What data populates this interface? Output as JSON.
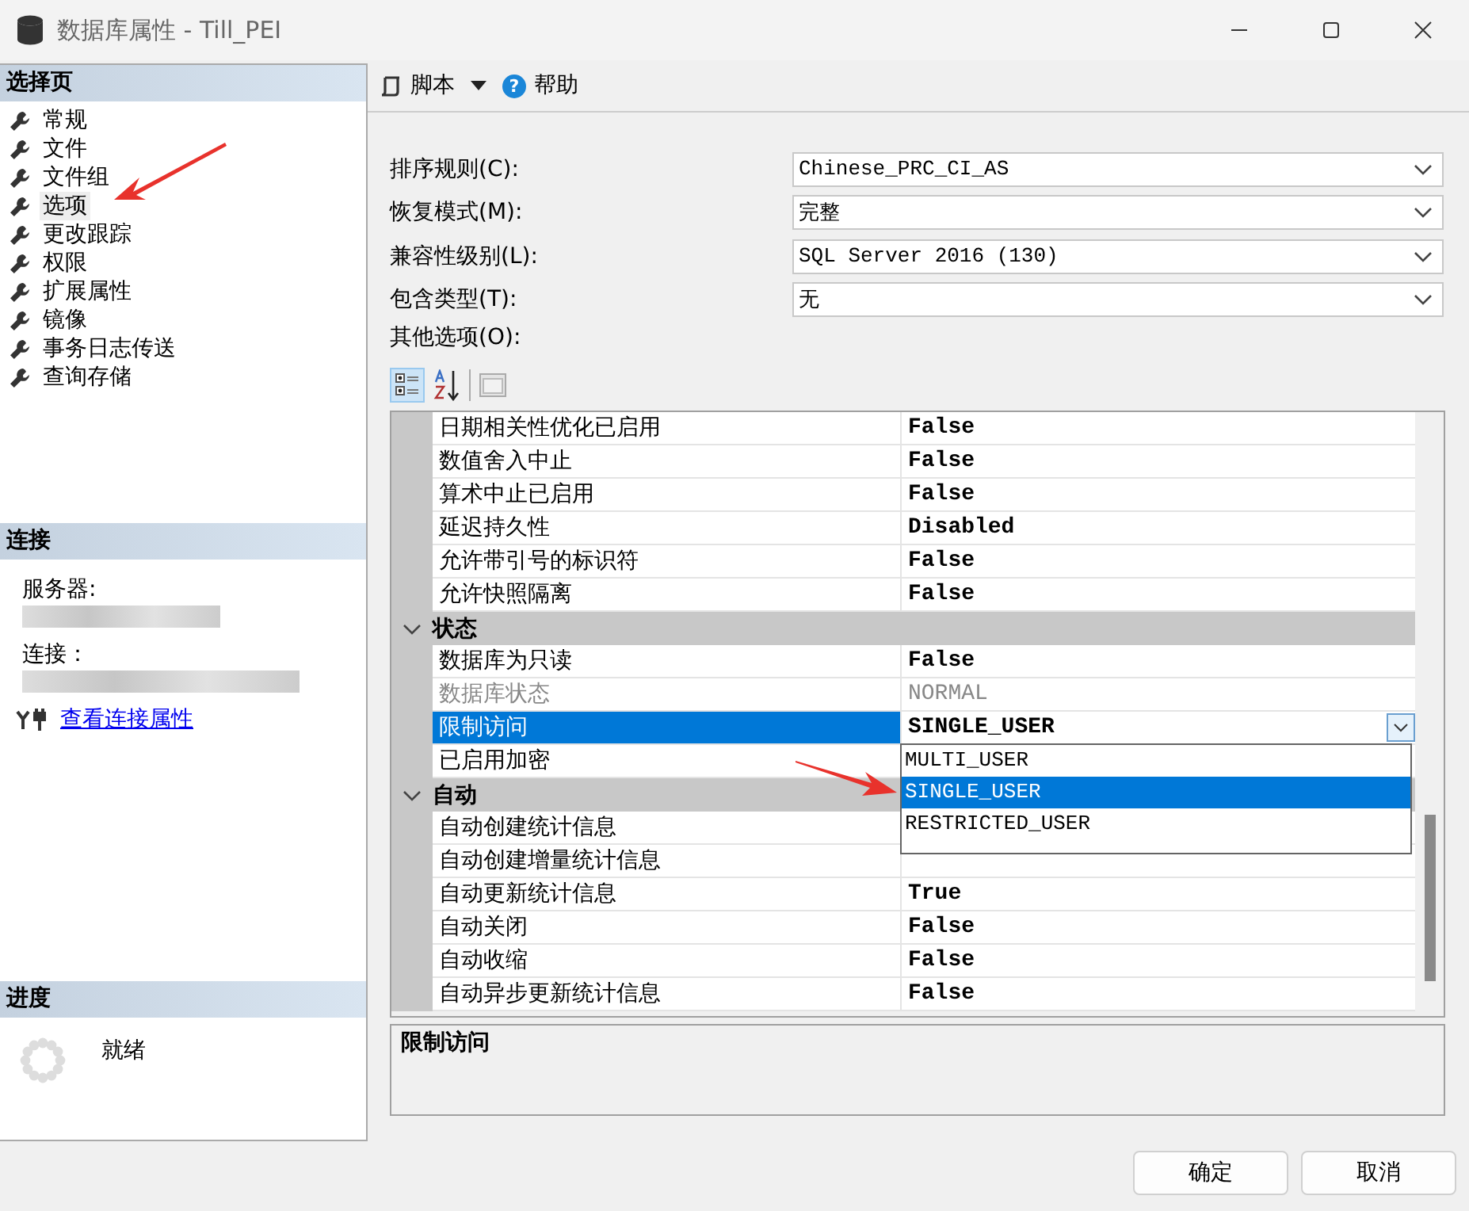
{
  "window": {
    "title": "数据库属性 - Till_PEI"
  },
  "sidebar": {
    "pages_header": "选择页",
    "pages": [
      {
        "label": "常规",
        "selected": false
      },
      {
        "label": "文件",
        "selected": false
      },
      {
        "label": "文件组",
        "selected": false
      },
      {
        "label": "选项",
        "selected": true
      },
      {
        "label": "更改跟踪",
        "selected": false
      },
      {
        "label": "权限",
        "selected": false
      },
      {
        "label": "扩展属性",
        "selected": false
      },
      {
        "label": "镜像",
        "selected": false
      },
      {
        "label": "事务日志传送",
        "selected": false
      },
      {
        "label": "查询存储",
        "selected": false
      }
    ],
    "connection_header": "连接",
    "server_label": "服务器:",
    "connection_label": "连接：",
    "connection_link": "查看连接属性",
    "progress_header": "进度",
    "progress_status": "就绪"
  },
  "toolbar": {
    "script": "脚本",
    "help_icon": "?",
    "help": "帮助"
  },
  "fields": [
    {
      "label": "排序规则(C):",
      "value": "Chinese_PRC_CI_AS"
    },
    {
      "label": "恢复模式(M):",
      "value": "完整"
    },
    {
      "label": "兼容性级别(L):",
      "value": "SQL Server 2016 (130)"
    },
    {
      "label": "包含类型(T):",
      "value": "无"
    }
  ],
  "other_options_label": "其他选项(O):",
  "grid_toolbar": {
    "categorized_selected": true,
    "alphabetical_selected": false
  },
  "grid": {
    "rows": [
      {
        "kind": "property",
        "name": "日期相关性优化已启用",
        "value": "False",
        "disabled": false,
        "selected": false
      },
      {
        "kind": "property",
        "name": "数值舍入中止",
        "value": "False",
        "disabled": false,
        "selected": false
      },
      {
        "kind": "property",
        "name": "算术中止已启用",
        "value": "False",
        "disabled": false,
        "selected": false
      },
      {
        "kind": "property",
        "name": "延迟持久性",
        "value": "Disabled",
        "disabled": false,
        "selected": false
      },
      {
        "kind": "property",
        "name": "允许带引号的标识符",
        "value": "False",
        "disabled": false,
        "selected": false
      },
      {
        "kind": "property",
        "name": "允许快照隔离",
        "value": "False",
        "disabled": false,
        "selected": false
      },
      {
        "kind": "category",
        "name": "状态",
        "expanded": true
      },
      {
        "kind": "property",
        "name": "数据库为只读",
        "value": "False",
        "disabled": false,
        "selected": false
      },
      {
        "kind": "property",
        "name": "数据库状态",
        "value": "NORMAL",
        "disabled": true,
        "selected": false
      },
      {
        "kind": "property",
        "name": "限制访问",
        "value": "SINGLE_USER",
        "disabled": false,
        "selected": true,
        "dropdown": [
          {
            "label": "MULTI_USER",
            "selected": false
          },
          {
            "label": "SINGLE_USER",
            "selected": true
          },
          {
            "label": "RESTRICTED_USER",
            "selected": false
          }
        ]
      },
      {
        "kind": "property",
        "name": "已启用加密",
        "disabled": false,
        "selected": false
      },
      {
        "kind": "category",
        "name": "自动",
        "expanded": true
      },
      {
        "kind": "property",
        "name": "自动创建统计信息",
        "disabled": false,
        "selected": false
      },
      {
        "kind": "property",
        "name": "自动创建增量统计信息",
        "disabled": false,
        "selected": false
      },
      {
        "kind": "property",
        "name": "自动更新统计信息",
        "value": "True",
        "disabled": false,
        "selected": false
      },
      {
        "kind": "property",
        "name": "自动关闭",
        "value": "False",
        "disabled": false,
        "selected": false
      },
      {
        "kind": "property",
        "name": "自动收缩",
        "value": "False",
        "disabled": false,
        "selected": false
      },
      {
        "kind": "property",
        "name": "自动异步更新统计信息",
        "value": "False",
        "disabled": false,
        "selected": false
      }
    ]
  },
  "description": {
    "title": "限制访问"
  },
  "buttons": [
    "确定",
    "取消"
  ]
}
